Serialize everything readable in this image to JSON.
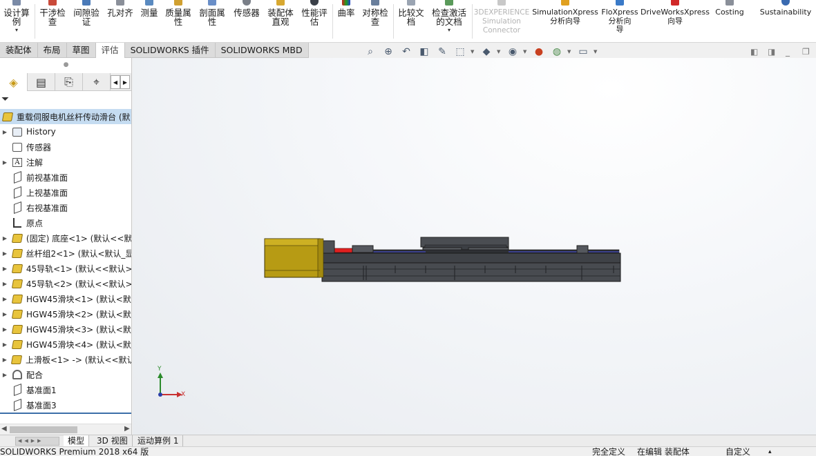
{
  "ribbon": {
    "buttons": [
      {
        "label": "设计算\n例",
        "caret": "▾"
      },
      {
        "label": "干涉检\n查"
      },
      {
        "label": "间隙验\n证"
      },
      {
        "label": "孔对齐"
      },
      {
        "label": "测量"
      },
      {
        "label": "质量属\n性"
      },
      {
        "label": "剖面属\n性"
      },
      {
        "label": "传感器"
      },
      {
        "label": "装配体\n直观"
      },
      {
        "label": "性能评\n估"
      },
      {
        "label": "曲率"
      },
      {
        "label": "对称检\n查"
      },
      {
        "label": "比较文\n档"
      },
      {
        "label": "检查激活\n的文档",
        "caret": "▾"
      },
      {
        "label": "3DEXPERIENCE\nSimulation\nConnector"
      },
      {
        "label": "SimulationXpress\n分析向导"
      },
      {
        "label": "FloXpress\n分析向\n导"
      },
      {
        "label": "DriveWorksXpress\n向导"
      },
      {
        "label": "Costing"
      },
      {
        "label": "Sustainability"
      }
    ]
  },
  "command_tabs": [
    "装配体",
    "布局",
    "草图",
    "评估",
    "SOLIDWORKS 插件",
    "SOLIDWORKS MBD"
  ],
  "tree": {
    "root": "重载伺服电机丝杆传动滑台 (默",
    "items": [
      {
        "label": "History",
        "expand": "▶"
      },
      {
        "label": "传感器",
        "expand": ""
      },
      {
        "label": "注解",
        "expand": "▶"
      },
      {
        "label": "前视基准面",
        "expand": ""
      },
      {
        "label": "上视基准面",
        "expand": ""
      },
      {
        "label": "右视基准面",
        "expand": ""
      },
      {
        "label": "原点",
        "expand": ""
      },
      {
        "label": "(固定) 底座<1> (默认<<默",
        "expand": "▶"
      },
      {
        "label": "丝杆组2<1> (默认<默认_显",
        "expand": "▶"
      },
      {
        "label": "45导轨<1> (默认<<默认>",
        "expand": "▶"
      },
      {
        "label": "45导轨<2> (默认<<默认>",
        "expand": "▶"
      },
      {
        "label": "HGW45滑块<1> (默认<默",
        "expand": "▶"
      },
      {
        "label": "HGW45滑块<2> (默认<默",
        "expand": "▶"
      },
      {
        "label": "HGW45滑块<3> (默认<默",
        "expand": "▶"
      },
      {
        "label": "HGW45滑块<4> (默认<默",
        "expand": "▶"
      },
      {
        "label": "上滑板<1> -> (默认<<默认",
        "expand": "▶"
      },
      {
        "label": "配合",
        "expand": "▶"
      },
      {
        "label": "基准面1",
        "expand": ""
      },
      {
        "label": "基准面3",
        "expand": ""
      }
    ]
  },
  "triad": {
    "y": "Y",
    "x": "X"
  },
  "bottom_tabs": [
    "模型",
    "3D 视图",
    "运动算例 1"
  ],
  "status": {
    "app": "SOLIDWORKS Premium 2018 x64 版",
    "defined": "完全定义",
    "editing": "在编辑 装配体",
    "units": "自定义",
    "caret": "▴"
  }
}
